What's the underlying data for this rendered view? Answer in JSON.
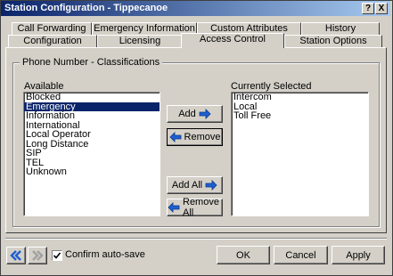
{
  "window": {
    "title": "Station Configuration - Tippecanoe"
  },
  "title_buttons": {
    "help": "?",
    "close": "X"
  },
  "tabs_row1": [
    {
      "label": "Call Forwarding"
    },
    {
      "label": "Emergency Information"
    },
    {
      "label": "Custom Attributes"
    },
    {
      "label": "History"
    }
  ],
  "tabs_row2": [
    {
      "label": "Configuration"
    },
    {
      "label": "Licensing"
    },
    {
      "label": "Access Control",
      "active": true
    },
    {
      "label": "Station Options"
    }
  ],
  "group": {
    "title": "Phone Number - Classifications",
    "available_label": "Available",
    "selected_label": "Currently Selected",
    "available": [
      "Blocked",
      "Emergency",
      "Information",
      "International",
      "Local Operator",
      "Long Distance",
      "SIP",
      "TEL",
      "Unknown"
    ],
    "available_selected": "Emergency",
    "selected": [
      "Intercom",
      "Local",
      "Toll Free"
    ]
  },
  "buttons": {
    "add": "Add",
    "remove": "Remove",
    "add_all": "Add All",
    "remove_all": "Remove All"
  },
  "footer": {
    "confirm_label": "Confirm auto-save",
    "confirm_checked": true,
    "ok": "OK",
    "cancel": "Cancel",
    "apply": "Apply"
  },
  "colors": {
    "selection": "#0a246a",
    "arrow": "#1e5fd0",
    "dialog_bg": "#d4d0c8"
  }
}
